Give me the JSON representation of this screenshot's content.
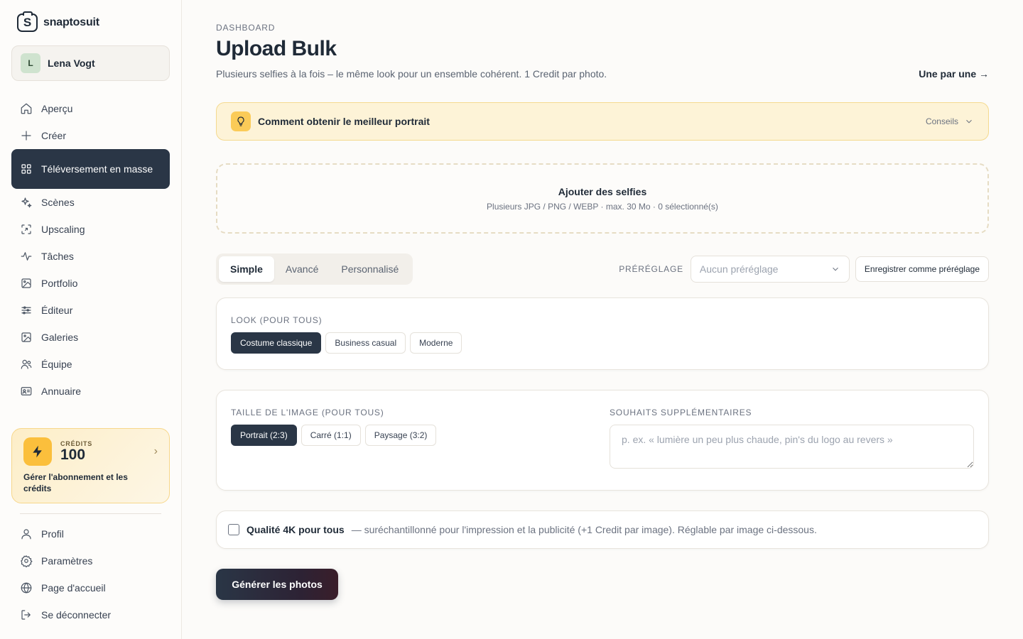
{
  "brand": {
    "name": "snaptosuit"
  },
  "user": {
    "initial": "L",
    "name": "Lena Vogt"
  },
  "nav": [
    {
      "label": "Aperçu",
      "icon": "home-icon"
    },
    {
      "label": "Créer",
      "icon": "plus-icon"
    },
    {
      "label": "Téléversement en masse",
      "icon": "grid-icon",
      "active": true
    },
    {
      "label": "Scènes",
      "icon": "sparkles-icon"
    },
    {
      "label": "Upscaling",
      "icon": "scan-icon"
    },
    {
      "label": "Tâches",
      "icon": "activity-icon"
    },
    {
      "label": "Portfolio",
      "icon": "image-icon"
    },
    {
      "label": "Éditeur",
      "icon": "sliders-icon"
    },
    {
      "label": "Galeries",
      "icon": "gallery-icon"
    },
    {
      "label": "Équipe",
      "icon": "users-icon"
    },
    {
      "label": "Annuaire",
      "icon": "id-card-icon"
    }
  ],
  "credits": {
    "label": "CRÉDITS",
    "value": "100",
    "manage": "Gérer l'abonnement et les crédits"
  },
  "nav_bottom": [
    {
      "label": "Profil",
      "icon": "user-icon"
    },
    {
      "label": "Paramètres",
      "icon": "gear-icon"
    },
    {
      "label": "Page d'accueil",
      "icon": "globe-icon"
    },
    {
      "label": "Se déconnecter",
      "icon": "logout-icon"
    }
  ],
  "header": {
    "eyebrow": "DASHBOARD",
    "title": "Upload Bulk",
    "subtitle": "Plusieurs selfies à la fois – le même look pour un ensemble cohérent. 1 Credit par photo.",
    "one_by_one": "Une par une →"
  },
  "tips": {
    "title": "Comment obtenir le meilleur portrait",
    "toggle": "Conseils"
  },
  "dropzone": {
    "title": "Ajouter des selfies",
    "subtitle": "Plusieurs JPG / PNG / WEBP · max. 30 Mo · 0 sélectionné(s)"
  },
  "mode_tabs": [
    {
      "label": "Simple",
      "active": true
    },
    {
      "label": "Avancé"
    },
    {
      "label": "Personnalisé"
    }
  ],
  "preset": {
    "label": "PRÉRÉGLAGE",
    "placeholder": "Aucun préréglage",
    "save_label": "Enregistrer comme préréglage"
  },
  "look": {
    "label": "LOOK (POUR TOUS)",
    "options": [
      {
        "label": "Costume classique",
        "active": true
      },
      {
        "label": "Business casual"
      },
      {
        "label": "Moderne"
      }
    ]
  },
  "size": {
    "label": "TAILLE DE L'IMAGE (POUR TOUS)",
    "options": [
      {
        "label": "Portrait (2:3)",
        "active": true
      },
      {
        "label": "Carré (1:1)"
      },
      {
        "label": "Paysage (3:2)"
      }
    ]
  },
  "wishes": {
    "label": "SOUHAITS SUPPLÉMENTAIRES",
    "placeholder": "p. ex. « lumière un peu plus chaude, pin's du logo au revers »"
  },
  "quality": {
    "label": "Qualité 4K pour tous",
    "description": "— suréchantillonné pour l'impression et la publicité (+1 Credit par image). Réglable par image ci-dessous."
  },
  "generate": {
    "label": "Générer les photos"
  }
}
